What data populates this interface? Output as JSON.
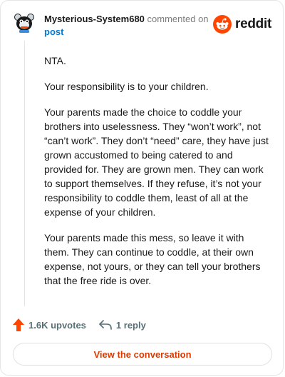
{
  "header": {
    "username": "Mysterious-System680",
    "meta_text": "commented on",
    "post_link": "post",
    "logo_text": "reddit"
  },
  "comment": {
    "paragraphs": [
      "NTA.",
      "Your responsibility is to your children.",
      "Your parents made the choice to coddle your brothers into uselessness. They “won’t work”, not “can’t work”. They don’t “need” care, they have just grown accustomed to being catered to and provided for. They are grown men. They can work to support themselves. If they refuse, it’s not your responsibility to coddle them, least of all at the expense of your children.",
      "Your parents made this mess, so leave it with them. They can continue to coddle, at their own expense, not yours, or they can tell your brothers that the free ride is over."
    ]
  },
  "actions": {
    "upvotes": "1.6K upvotes",
    "replies": "1 reply"
  },
  "cta": {
    "label": "View the conversation"
  },
  "colors": {
    "brand": "#ff4500",
    "link": "#0079d3",
    "cta_text": "#d93a00"
  },
  "icons": [
    "avatar",
    "reddit-logo-icon",
    "upvote-icon",
    "reply-icon"
  ]
}
